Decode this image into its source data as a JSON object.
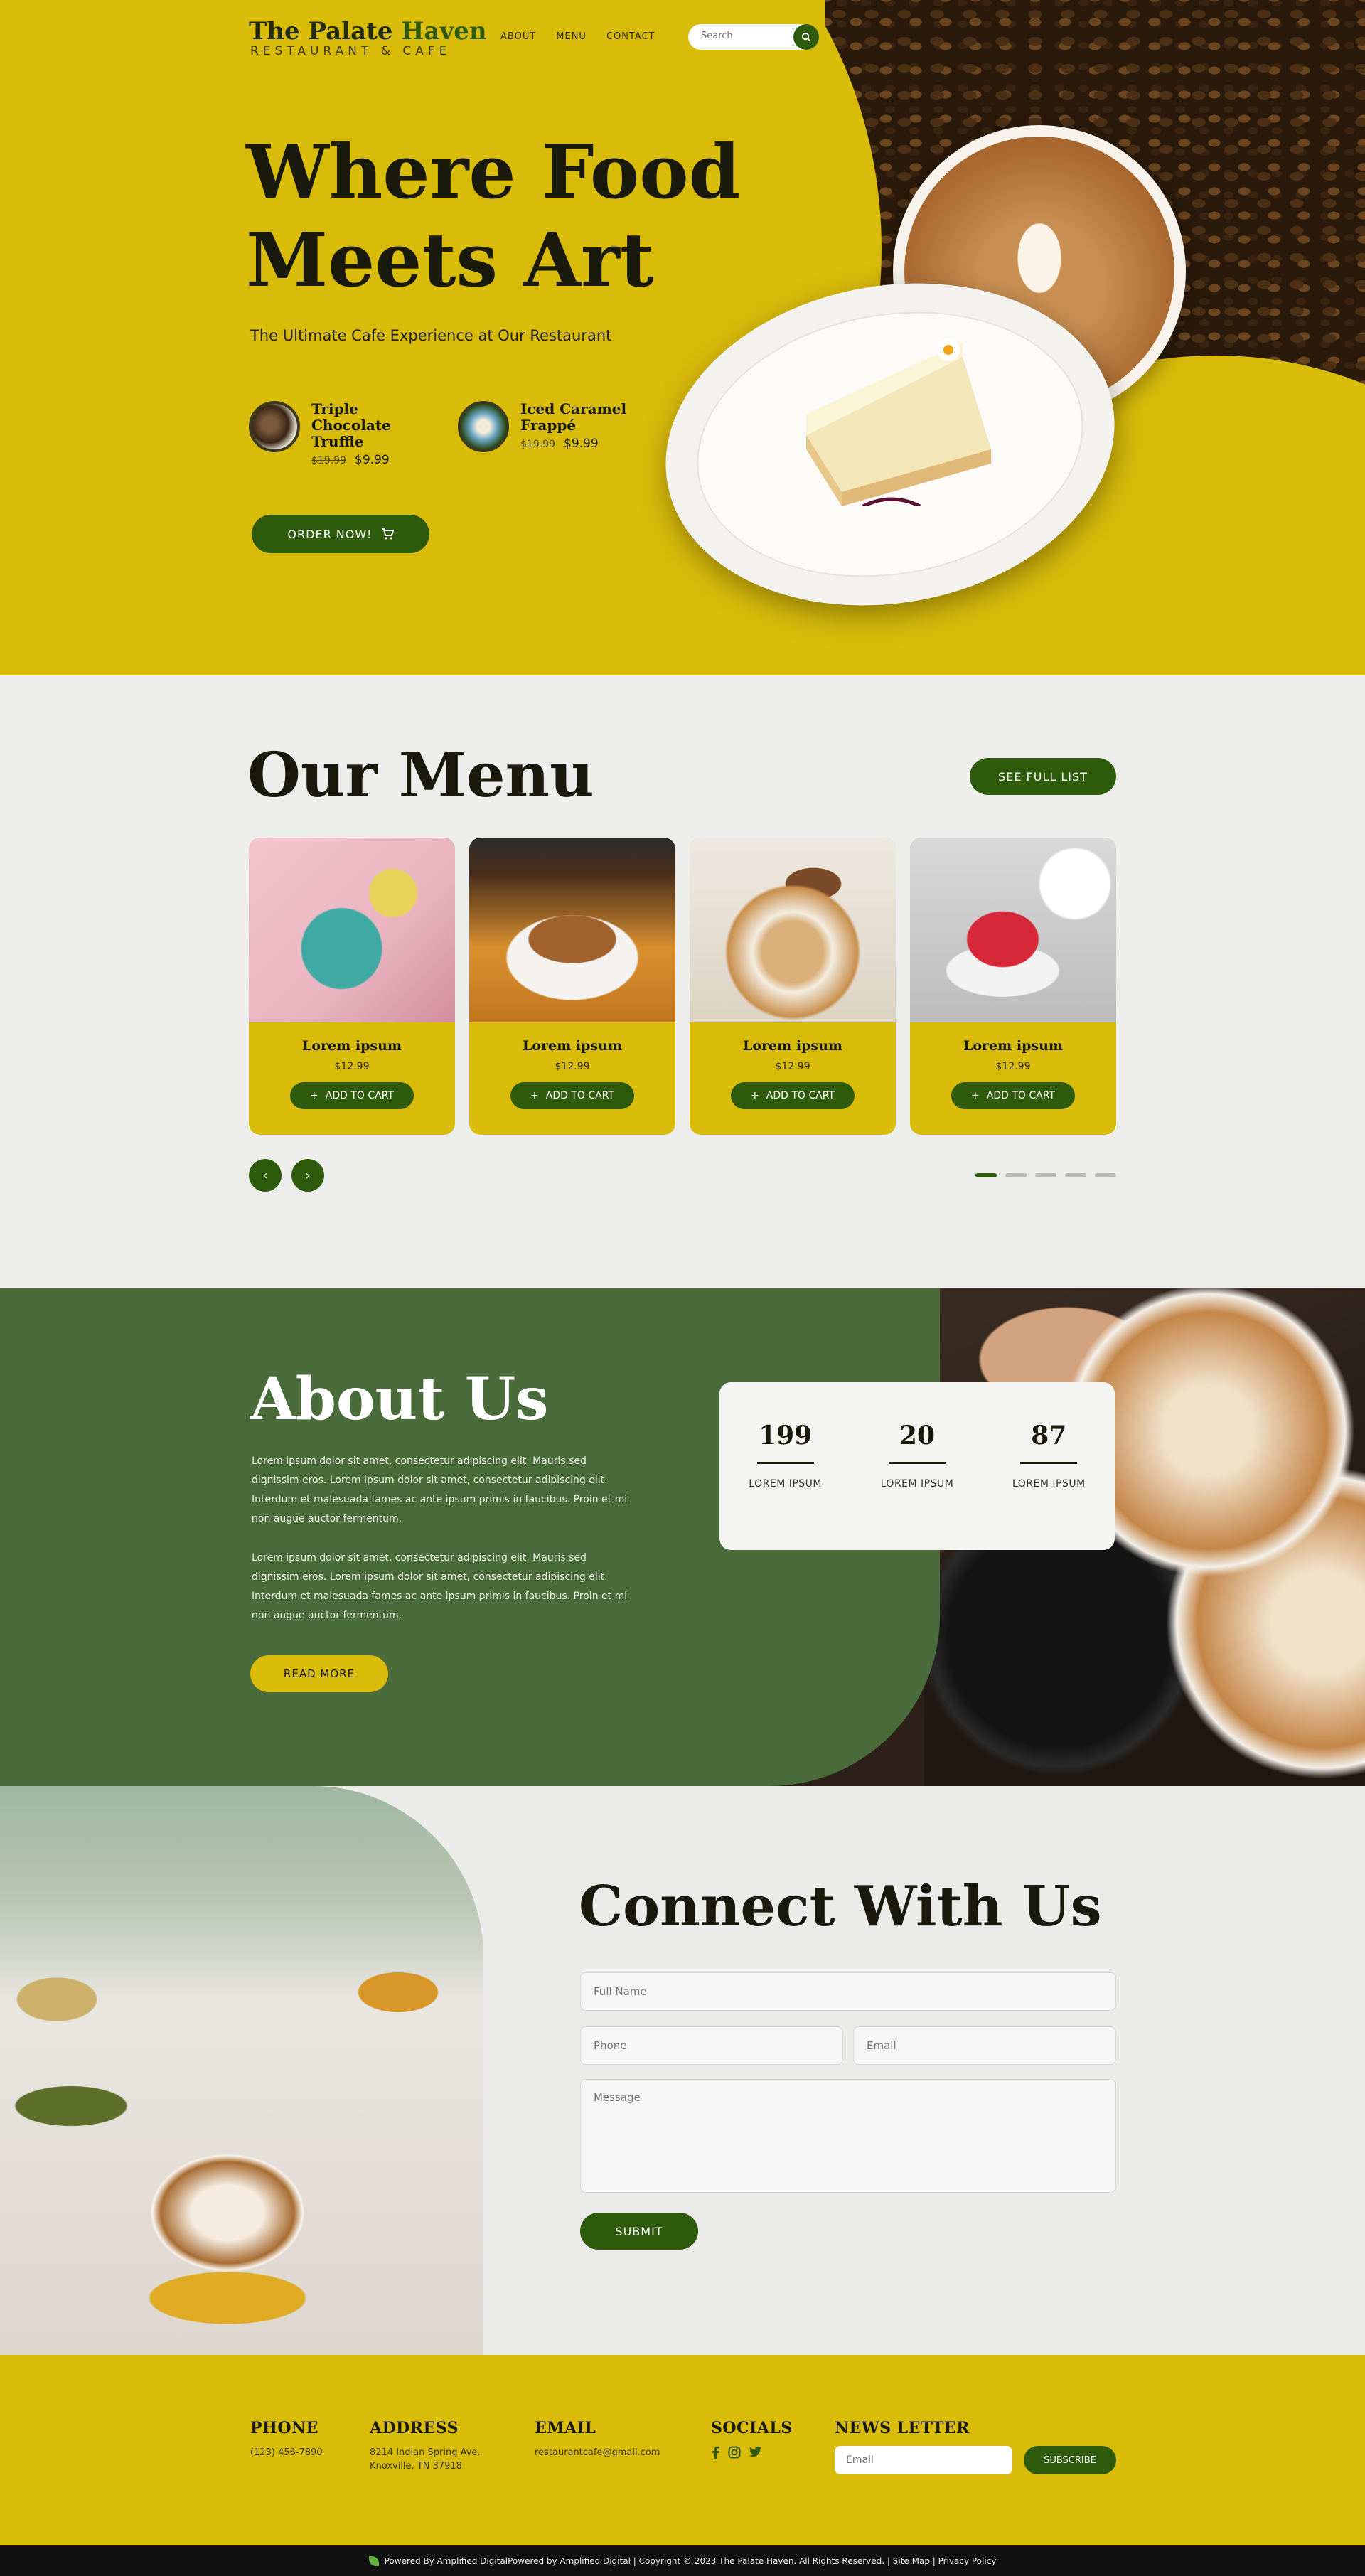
{
  "brand": {
    "title_part1": "The Palate ",
    "title_part2": "Haven",
    "subtitle": "RESTAURANT & CAFE"
  },
  "nav": {
    "links": [
      "ABOUT",
      "MENU",
      "CONTACT"
    ],
    "search_placeholder": "Search"
  },
  "hero": {
    "title_line1": "Where Food",
    "title_line2": "Meets Art",
    "tagline": "The Ultimate Cafe  Experience at Our  Restaurant",
    "items": [
      {
        "name": "Triple Chocolate Truffle",
        "old_price": "$19.99",
        "price": "$9.99"
      },
      {
        "name": "Iced Caramel Frappé",
        "old_price": "$19.99",
        "price": "$9.99"
      }
    ],
    "order_label": "ORDER NOW!"
  },
  "menu": {
    "title": "Our Menu",
    "see_full_label": "SEE  FULL  LIST",
    "items": [
      {
        "name": "Lorem ipsum",
        "price": "$12.99",
        "cart_label": "ADD TO CART"
      },
      {
        "name": "Lorem ipsum",
        "price": "$12.99",
        "cart_label": "ADD TO CART"
      },
      {
        "name": "Lorem ipsum",
        "price": "$12.99",
        "cart_label": "ADD TO CART"
      },
      {
        "name": "Lorem ipsum",
        "price": "$12.99",
        "cart_label": "ADD TO CART"
      }
    ],
    "prev_symbol": "‹",
    "next_symbol": "›"
  },
  "about": {
    "title": "About Us",
    "paragraph1": "Lorem ipsum dolor sit amet, consectetur adipiscing elit.  Mauris sed dignissim eros.  Lorem ipsum dolor sit amet, consectetur adipiscing elit.  Interdum et malesuada fames ac ante ipsum primis in faucibus.  Proin et mi non augue auctor fermentum.",
    "paragraph2": "Lorem ipsum dolor sit amet, consectetur adipiscing elit.  Mauris sed dignissim eros.  Lorem ipsum dolor sit amet, consectetur adipiscing elit.  Interdum et malesuada fames ac ante ipsum primis in faucibus.  Proin et mi non augue auctor fermentum.",
    "read_more_label": "READ  MORE",
    "stats": [
      {
        "value": "199",
        "label": "LOREM  IPSUM"
      },
      {
        "value": "20",
        "label": "LOREM  IPSUM"
      },
      {
        "value": "87",
        "label": "LOREM  IPSUM"
      }
    ]
  },
  "contact": {
    "title": "Connect With Us",
    "full_name_placeholder": "Full Name",
    "phone_placeholder": "Phone",
    "email_placeholder": "Email",
    "message_placeholder": "Message",
    "submit_label": "SUBMIT"
  },
  "footer": {
    "phone_heading": "PHONE",
    "phone_value": "(123) 456-7890",
    "address_heading": "ADDRESS",
    "address_line1": "8214  Indian Spring Ave.",
    "address_line2": "Knoxville, TN 37918",
    "email_heading": "EMAIL",
    "email_value": "restaurantcafe@gmail.com",
    "socials_heading": "SOCIALS",
    "newsletter_heading": "NEWS LETTER",
    "newsletter_placeholder": "Email",
    "subscribe_label": "SUBSCRIBE",
    "bottom_text": "Powered By Amplified DigitalPowered by Amplified Digital | Copyright © 2023 The Palate Haven. All Rights Reserved. | Site Map | Privacy Policy"
  },
  "colors": {
    "accent_yellow": "#d9bb0a",
    "accent_green": "#2d5a0b",
    "about_green": "#4a6b3a",
    "ink": "#1a1a0c"
  },
  "icons": [
    "search-icon",
    "cart-icon",
    "plus-icon",
    "chevron-left-icon",
    "chevron-right-icon",
    "facebook-icon",
    "instagram-icon",
    "twitter-icon",
    "leaf-icon"
  ]
}
